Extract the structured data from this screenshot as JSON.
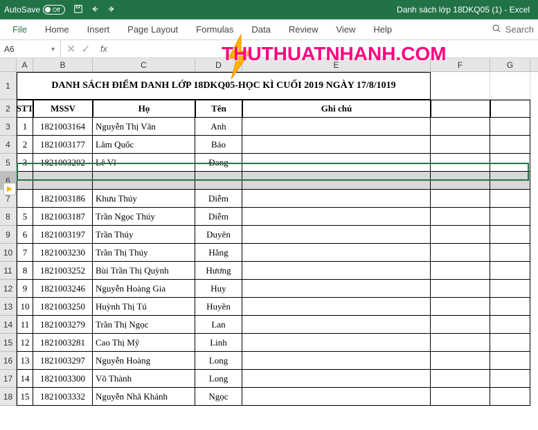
{
  "window": {
    "autosave_label": "AutoSave",
    "autosave_state": "Off",
    "doc_title": "Danh sách lớp 18DKQ05 (1)  -  Excel"
  },
  "ribbon": {
    "tabs": [
      "File",
      "Home",
      "Insert",
      "Page Layout",
      "Formulas",
      "Data",
      "Review",
      "View",
      "Help"
    ],
    "search_label": "Search"
  },
  "namebox": {
    "ref": "A6"
  },
  "watermark": "THUTHUATNHANH.COM",
  "columns": [
    "A",
    "B",
    "C",
    "D",
    "E",
    "F",
    "G"
  ],
  "sheet": {
    "title": "DANH SÁCH ĐIỂM DANH LỚP 18DKQ05-HỌC KÌ CUỐI 2019 NGÀY 17/8/1019",
    "headers": {
      "stt": "STT",
      "mssv": "MSSV",
      "ho": "Họ",
      "ten": "Tên",
      "ghichu": "Ghi chú"
    },
    "rows": [
      {
        "r": 3,
        "stt": "1",
        "mssv": "1821003164",
        "ho": "Nguyễn Thị Vân",
        "ten": "Anh"
      },
      {
        "r": 4,
        "stt": "2",
        "mssv": "1821003177",
        "ho": "Lâm Quốc",
        "ten": "Bảo"
      },
      {
        "r": 5,
        "stt": "3",
        "mssv": "1821003202",
        "ho": "Lê Vĩ",
        "ten": "Đang"
      },
      {
        "r": 7,
        "stt": "",
        "mssv": "1821003186",
        "ho": "Khưu Thúy",
        "ten": "Diễm"
      },
      {
        "r": 8,
        "stt": "5",
        "mssv": "1821003187",
        "ho": "Trần Ngọc Thúy",
        "ten": "Diễm"
      },
      {
        "r": 9,
        "stt": "6",
        "mssv": "1821003197",
        "ho": "Trần Thúy",
        "ten": "Duyên"
      },
      {
        "r": 10,
        "stt": "7",
        "mssv": "1821003230",
        "ho": "Trần Thị Thúy",
        "ten": "Hằng"
      },
      {
        "r": 11,
        "stt": "8",
        "mssv": "1821003252",
        "ho": "Bùi Trần Thị Quỳnh",
        "ten": "Hương"
      },
      {
        "r": 12,
        "stt": "9",
        "mssv": "1821003246",
        "ho": "Nguyễn Hoàng Gia",
        "ten": "Huy"
      },
      {
        "r": 13,
        "stt": "10",
        "mssv": "1821003250",
        "ho": "Huỳnh Thị Tú",
        "ten": "Huyền"
      },
      {
        "r": 14,
        "stt": "11",
        "mssv": "1821003279",
        "ho": "Trần Thị Ngọc",
        "ten": "Lan"
      },
      {
        "r": 15,
        "stt": "12",
        "mssv": "1821003281",
        "ho": "Cao Thị Mỹ",
        "ten": "Linh"
      },
      {
        "r": 16,
        "stt": "13",
        "mssv": "1821003297",
        "ho": "Nguyễn Hoàng",
        "ten": "Long"
      },
      {
        "r": 17,
        "stt": "14",
        "mssv": "1821003300",
        "ho": "Võ Thành",
        "ten": "Long"
      },
      {
        "r": 18,
        "stt": "15",
        "mssv": "1821003332",
        "ho": "Nguyễn Nhã Khánh",
        "ten": "Ngọc"
      }
    ]
  }
}
